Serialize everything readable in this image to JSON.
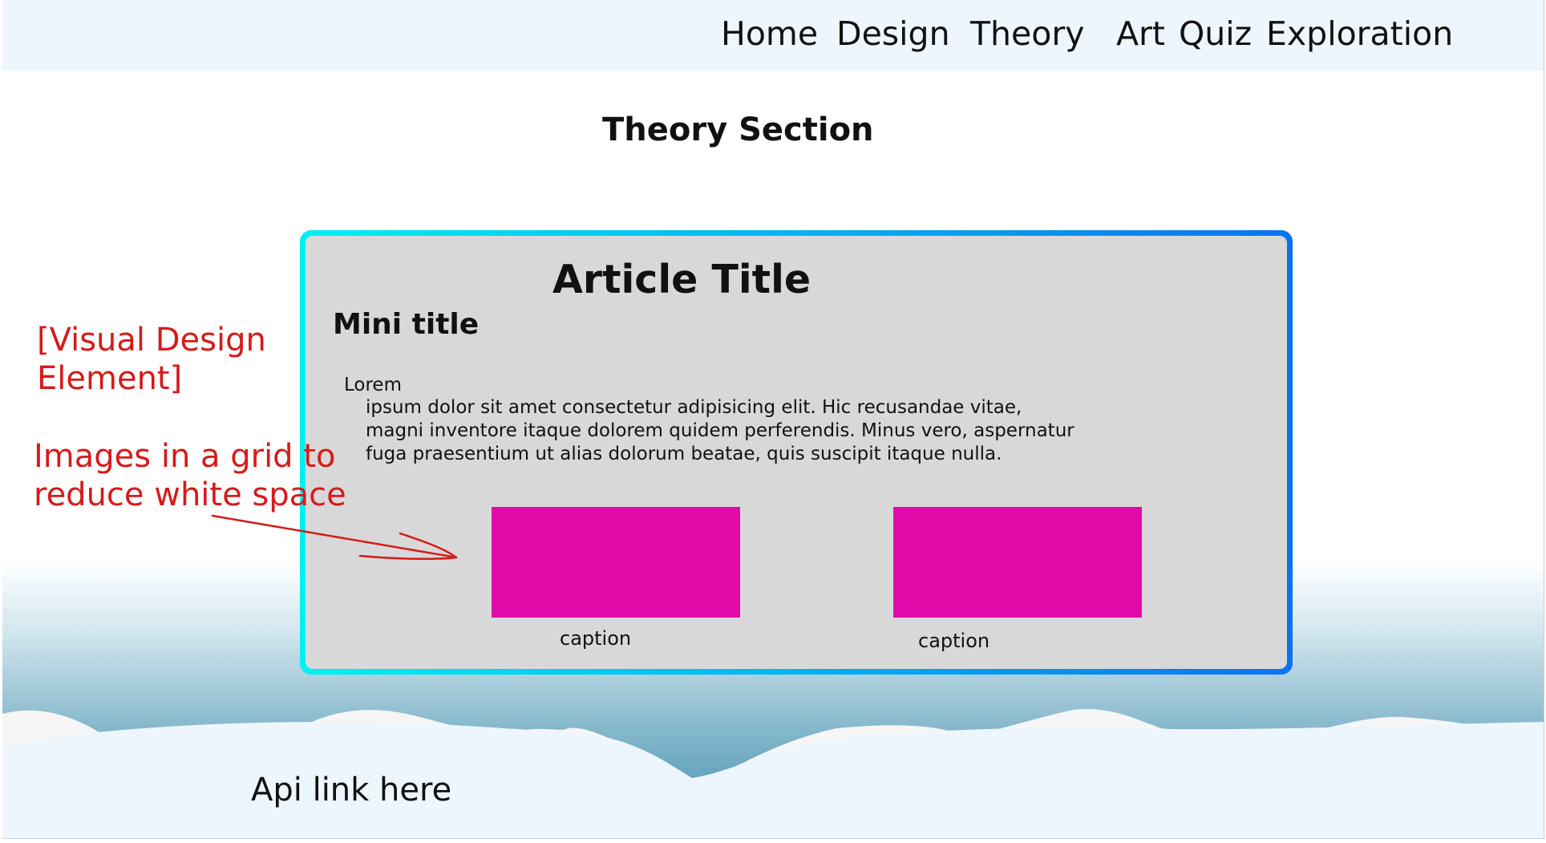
{
  "nav": {
    "items": [
      {
        "label": "Home"
      },
      {
        "label": "Design"
      },
      {
        "label": "Theory"
      },
      {
        "label": "Art"
      },
      {
        "label": "Quiz"
      },
      {
        "label": "Exploration"
      }
    ]
  },
  "page": {
    "section_title": "Theory Section"
  },
  "article": {
    "title": "Article Title",
    "mini_title": "Mini title",
    "first_word": "Lorem",
    "body_lines": [
      "ipsum dolor sit amet consectetur adipisicing elit. Hic recusandae vitae,",
      "magni inventore itaque dolorem quidem perferendis. Minus vero, aspernatur",
      "fuga praesentium ut alias dolorum beatae, quis suscipit itaque nulla."
    ],
    "images": [
      {
        "caption": "caption",
        "color": "#e00aa9"
      },
      {
        "caption": "caption",
        "color": "#e00aa9"
      }
    ],
    "border_gradient": [
      "#00f0f0",
      "#0a74f0"
    ]
  },
  "annotations": {
    "visual_element": [
      "[Visual Design",
      "Element]"
    ],
    "grid_note": [
      "Images in a grid to",
      "reduce white space"
    ],
    "color": "#d61a1a"
  },
  "footer": {
    "api_link": "Api link here"
  }
}
